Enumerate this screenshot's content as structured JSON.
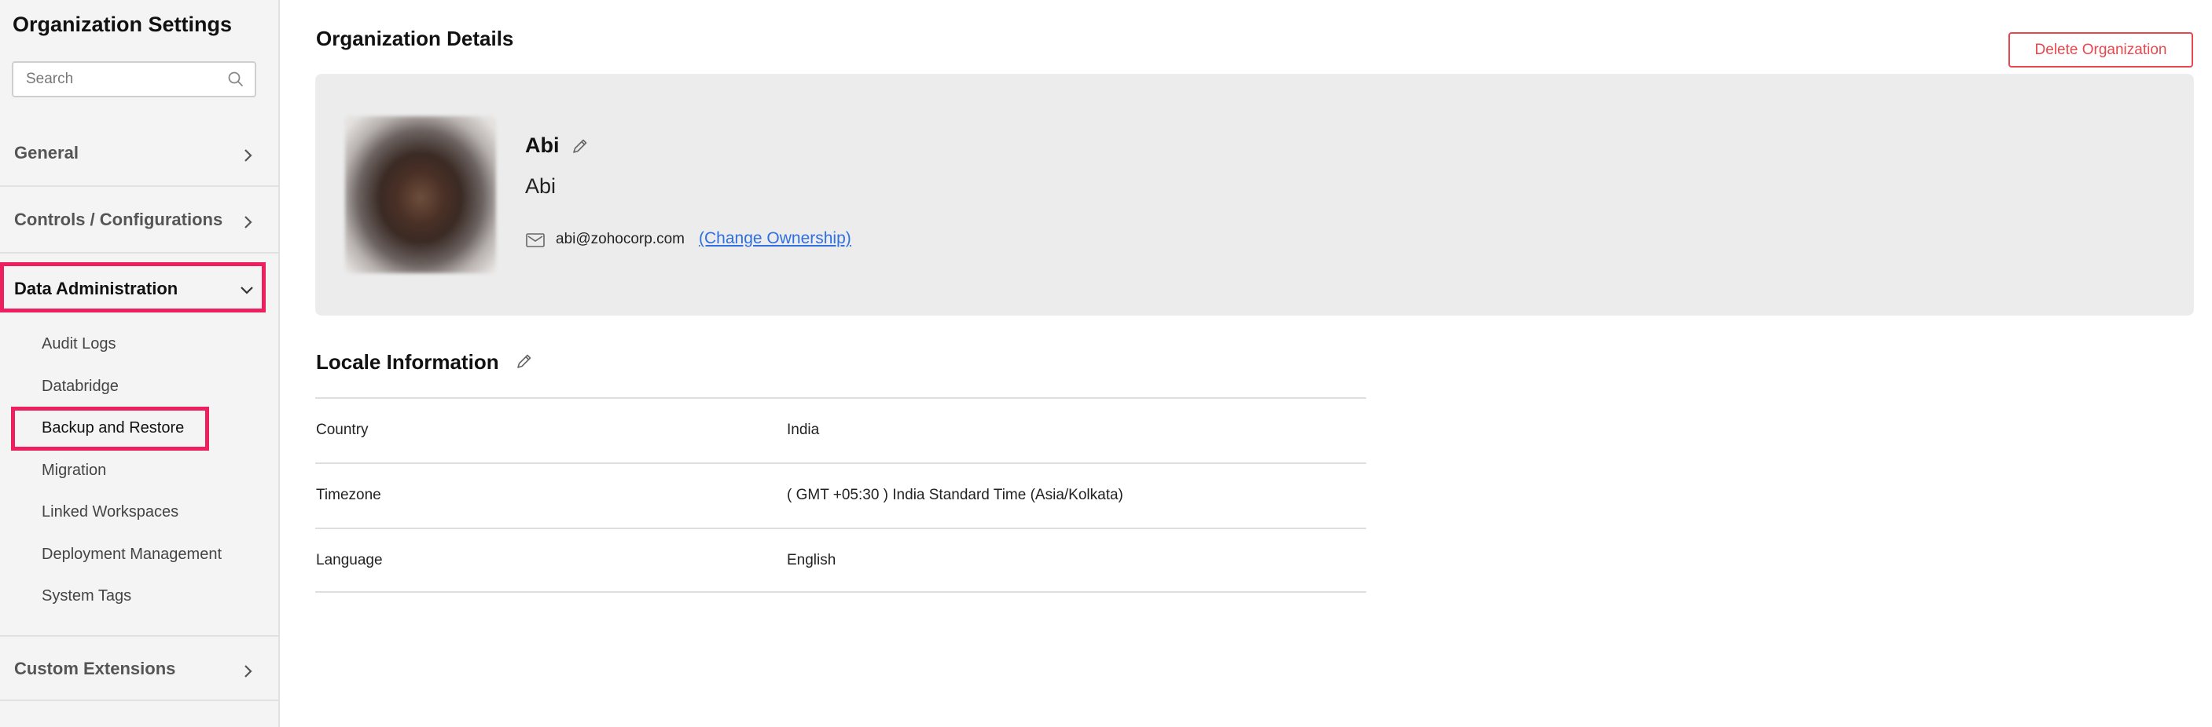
{
  "sidebar": {
    "title": "Organization Settings",
    "search": {
      "placeholder": "Search",
      "value": ""
    },
    "sections": [
      {
        "label": "General",
        "icon": "chevron-right-icon"
      },
      {
        "label": "Controls / Configurations",
        "icon": "chevron-right-icon"
      },
      {
        "label": "Data Administration",
        "icon": "chevron-down-icon",
        "expanded": true,
        "highlighted": true
      },
      {
        "label": "Custom Extensions",
        "icon": "chevron-right-icon"
      }
    ],
    "data_admin_items": [
      {
        "label": "Audit Logs"
      },
      {
        "label": "Databridge"
      },
      {
        "label": "Backup and Restore",
        "highlighted": true
      },
      {
        "label": "Migration"
      },
      {
        "label": "Linked Workspaces"
      },
      {
        "label": "Deployment Management"
      },
      {
        "label": "System Tags"
      }
    ]
  },
  "main": {
    "title": "Organization Details",
    "delete_button": "Delete Organization",
    "org": {
      "name_bold": "Abi",
      "name": "Abi",
      "email": "abi@zohocorp.com",
      "change_ownership": "(Change Ownership)"
    },
    "locale": {
      "title": "Locale Information",
      "rows": [
        {
          "key": "Country",
          "value": "India"
        },
        {
          "key": "Timezone",
          "value": "( GMT +05:30 ) India Standard Time (Asia/Kolkata)"
        },
        {
          "key": "Language",
          "value": "English"
        }
      ]
    }
  },
  "colors": {
    "highlight": "#ee1f5f",
    "danger": "#e8474f",
    "link": "#2f6fdf",
    "sidebar_bg": "#f4f4f4",
    "card_bg": "#ececec"
  }
}
